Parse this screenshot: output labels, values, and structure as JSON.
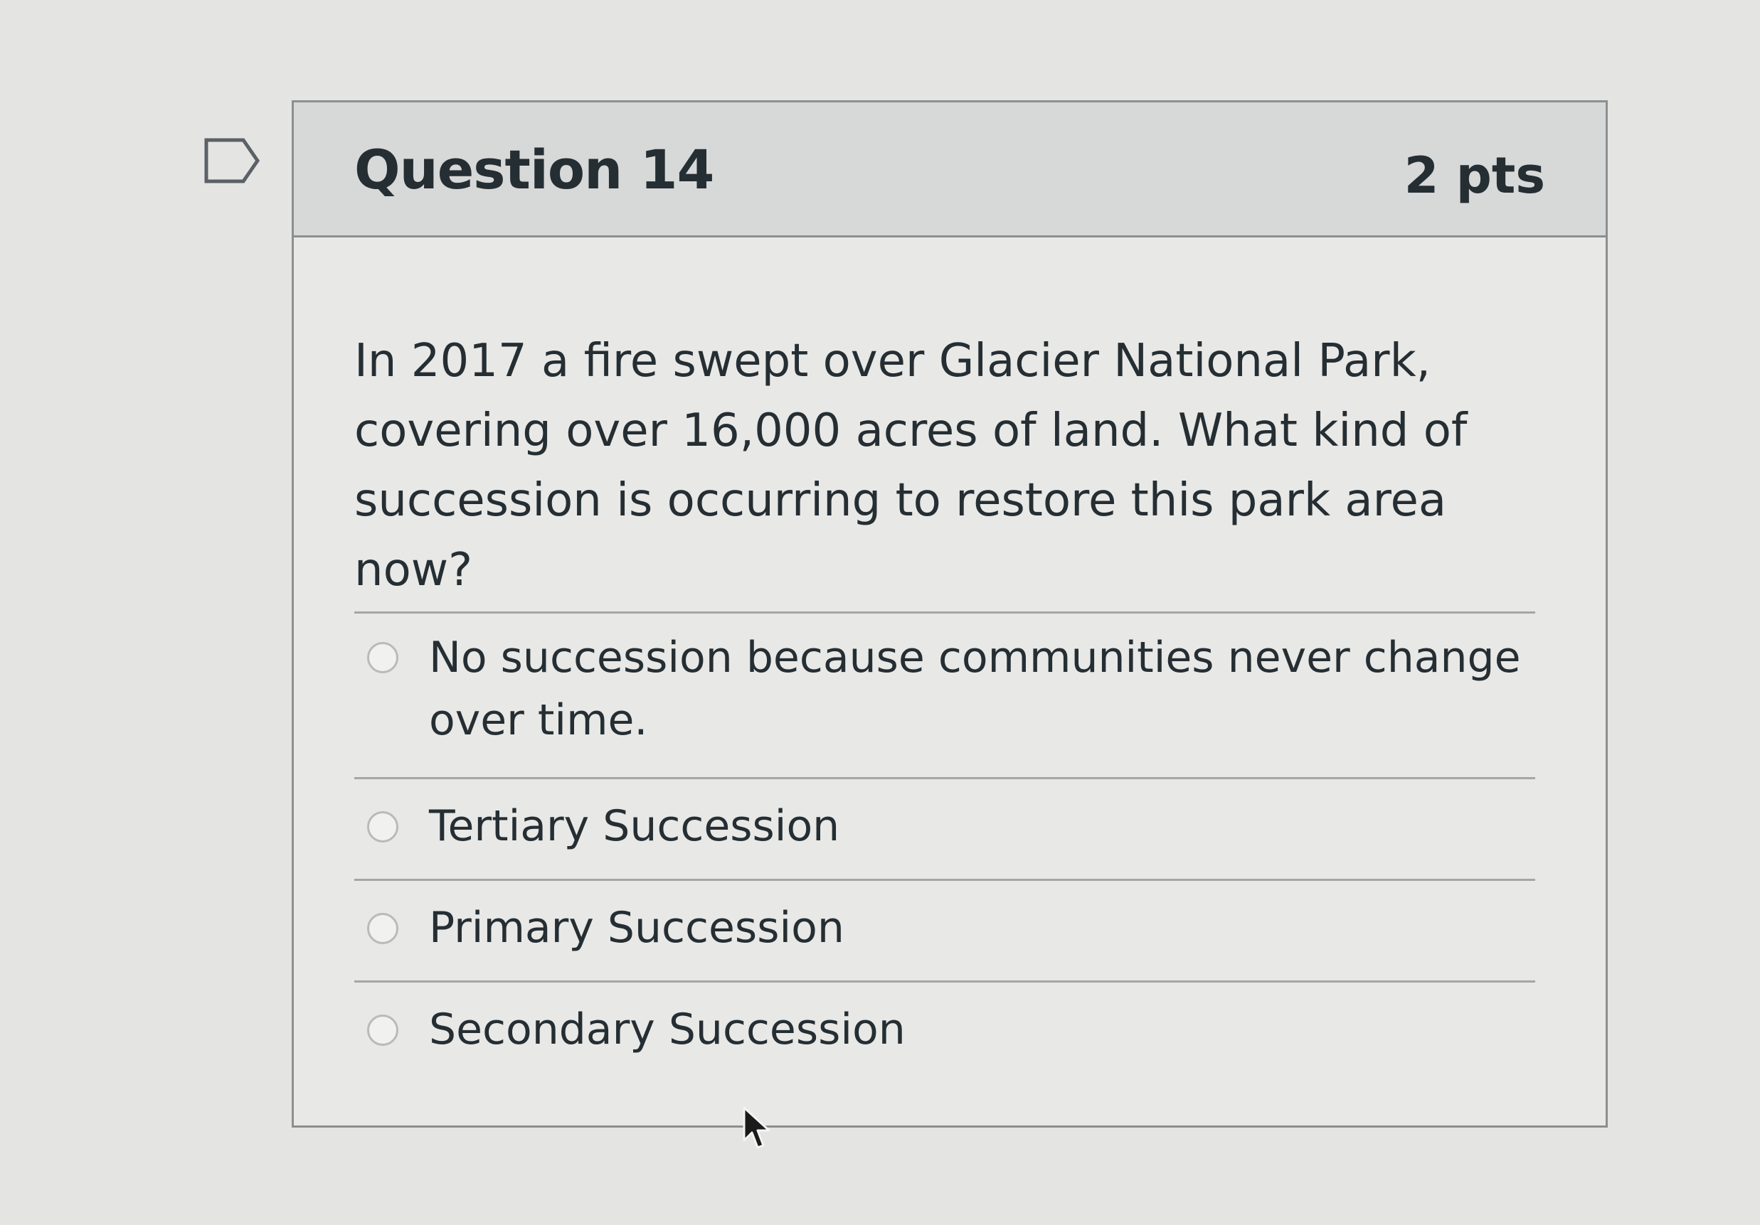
{
  "question": {
    "title": "Question 14",
    "points": "2 pts",
    "text": "In 2017 a fire swept over Glacier National Park, covering over 16,000 acres of land. What kind of succession is occurring to restore this park area now?"
  },
  "answers": [
    {
      "label": "No succession because communities never change over time.",
      "selected": false
    },
    {
      "label": "Tertiary Succession",
      "selected": false
    },
    {
      "label": "Primary Succession",
      "selected": false
    },
    {
      "label": "Secondary Succession",
      "selected": false
    }
  ],
  "icons": {
    "bookmark": "bookmark-icon",
    "radio": "radio-unselected-icon",
    "cursor": "mouse-pointer-icon"
  }
}
